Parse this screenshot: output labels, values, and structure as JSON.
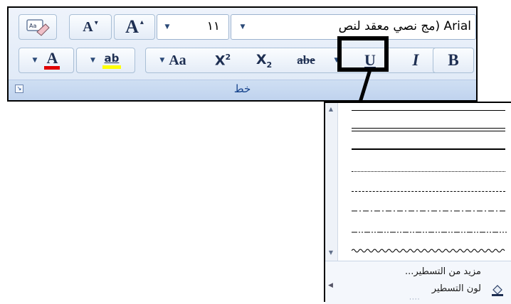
{
  "group": {
    "title": "خط",
    "font_name": "مج نصي معقد لنص) Arial",
    "font_size": "١١",
    "buttons": {
      "bold": "B",
      "italic": "I",
      "underline": "U",
      "strikethrough": "abe",
      "subscript": "X",
      "superscript": "X",
      "change_case": "Aa",
      "grow_font": "A",
      "shrink_font": "A",
      "clear_format": "Aa",
      "highlight": "ab",
      "font_color": "A"
    },
    "colors": {
      "highlight": "#ffff00",
      "font_color": "#e00000",
      "underline_highlight_box": "#000000"
    }
  },
  "gallery": {
    "styles": [
      "double",
      "thick",
      "dotted",
      "dashed",
      "dash-dot",
      "dash-dot-dot",
      "wavy"
    ],
    "more_underlines": "مزيد من التسطير...",
    "underline_color": "لون التسطير"
  }
}
